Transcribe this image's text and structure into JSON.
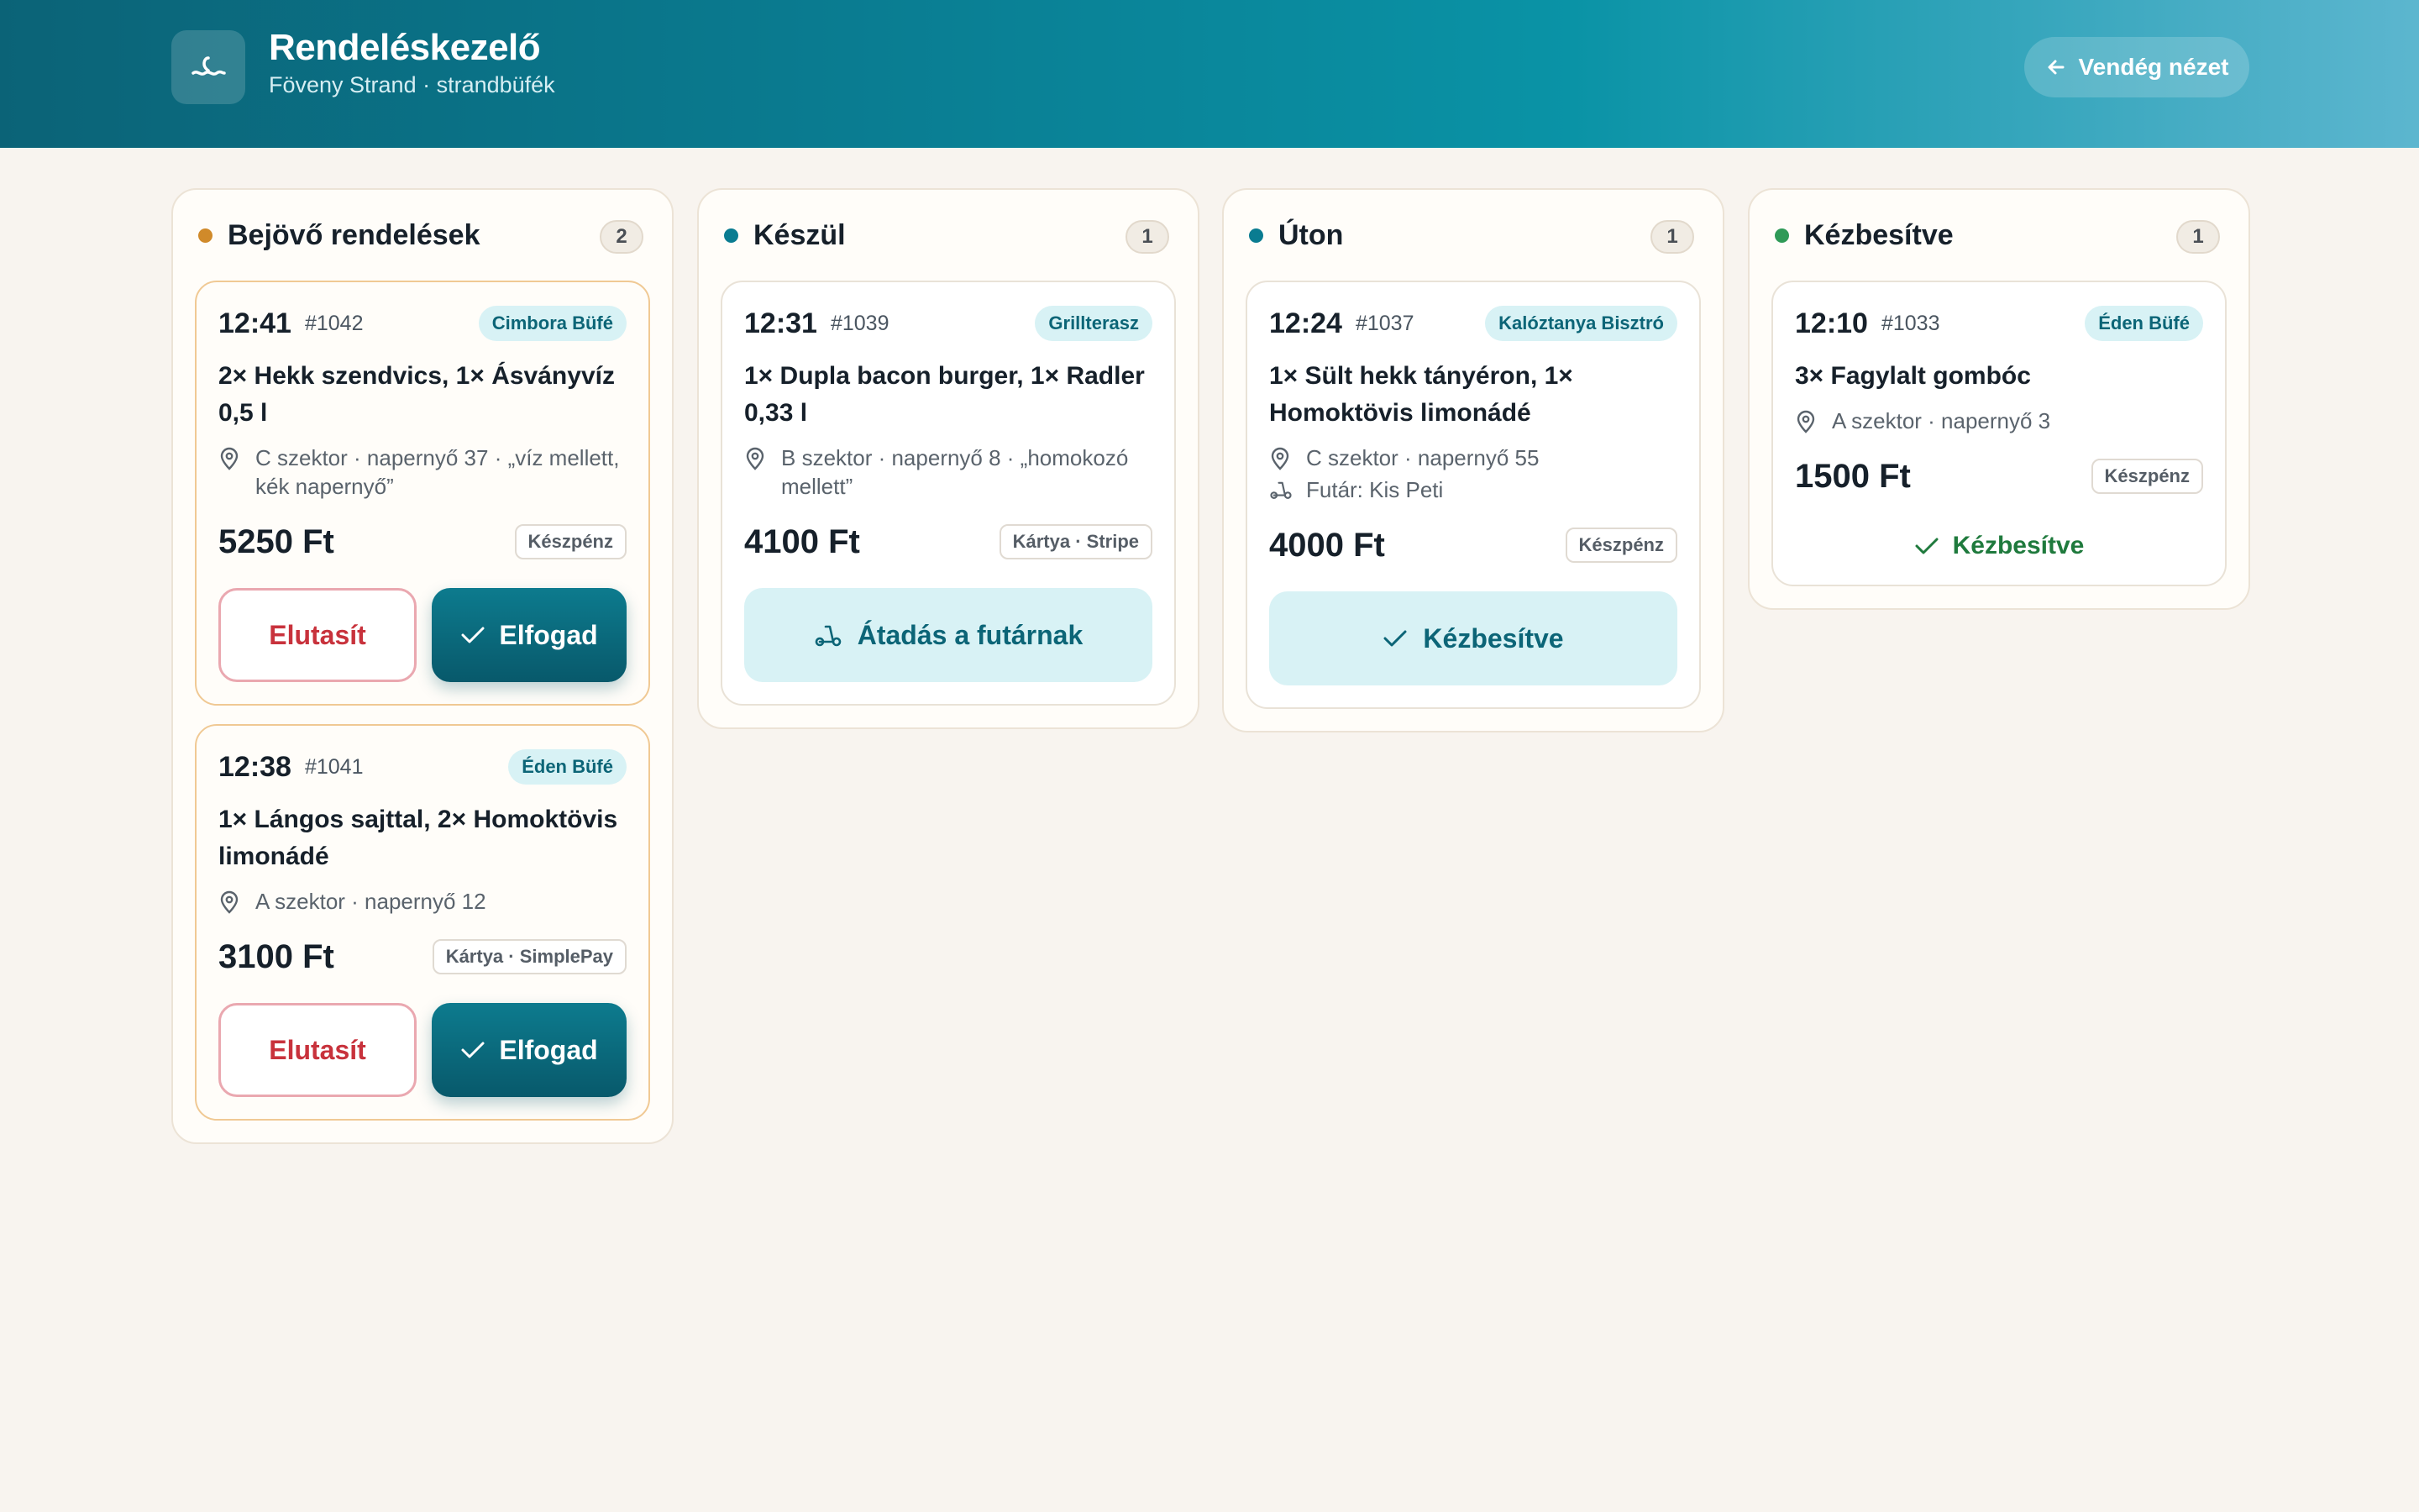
{
  "header": {
    "title": "Rendeléskezelő",
    "subtitle": "Föveny Strand · strandbüfék",
    "guest_button": "Vendég nézet"
  },
  "colors": {
    "incoming_dot": "#d08a2a",
    "preparing_dot": "#0a7c91",
    "en_route_dot": "#0a7c91",
    "delivered_dot": "#2f9a57",
    "accent": "#0a6d80",
    "reject": "#c8323c",
    "success": "#1f7a3d"
  },
  "columns": [
    {
      "title": "Bejövő rendelések",
      "count": "2",
      "cards": [
        {
          "time": "12:41",
          "order_no": "#1042",
          "venue": "Cimbora Büfé",
          "items": "2× Hekk szendvics, 1× Ásványvíz 0,5 l",
          "location": "C szektor · napernyő 37 · „víz mellett, kék napernyő”",
          "price": "5250 Ft",
          "payment": "Készpénz",
          "reject_label": "Elutasít",
          "accept_label": "Elfogad"
        },
        {
          "time": "12:38",
          "order_no": "#1041",
          "venue": "Éden Büfé",
          "items": "1× Lángos sajttal, 2× Homoktövis limonádé",
          "location": "A szektor · napernyő 12",
          "price": "3100 Ft",
          "payment": "Kártya · SimplePay",
          "reject_label": "Elutasít",
          "accept_label": "Elfogad"
        }
      ]
    },
    {
      "title": "Készül",
      "count": "1",
      "cards": [
        {
          "time": "12:31",
          "order_no": "#1039",
          "venue": "Grillterasz",
          "items": "1× Dupla bacon burger, 1× Radler 0,33 l",
          "location": "B szektor · napernyő 8 · „homokozó mellett”",
          "price": "4100 Ft",
          "payment": "Kártya · Stripe",
          "action_label": "Átadás a futárnak"
        }
      ]
    },
    {
      "title": "Úton",
      "count": "1",
      "cards": [
        {
          "time": "12:24",
          "order_no": "#1037",
          "venue": "Kalóztanya Bisztró",
          "items": "1× Sült hekk tányéron, 1× Homoktövis limonádé",
          "location": "C szektor · napernyő 55",
          "courier": "Futár: Kis Peti",
          "price": "4000 Ft",
          "payment": "Készpénz",
          "action_label": "Kézbesítve"
        }
      ]
    },
    {
      "title": "Kézbesítve",
      "count": "1",
      "cards": [
        {
          "time": "12:10",
          "order_no": "#1033",
          "venue": "Éden Büfé",
          "items": "3× Fagylalt gombóc",
          "location": "A szektor · napernyő 3",
          "price": "1500 Ft",
          "payment": "Készpénz",
          "status_label": "Kézbesítve"
        }
      ]
    }
  ]
}
